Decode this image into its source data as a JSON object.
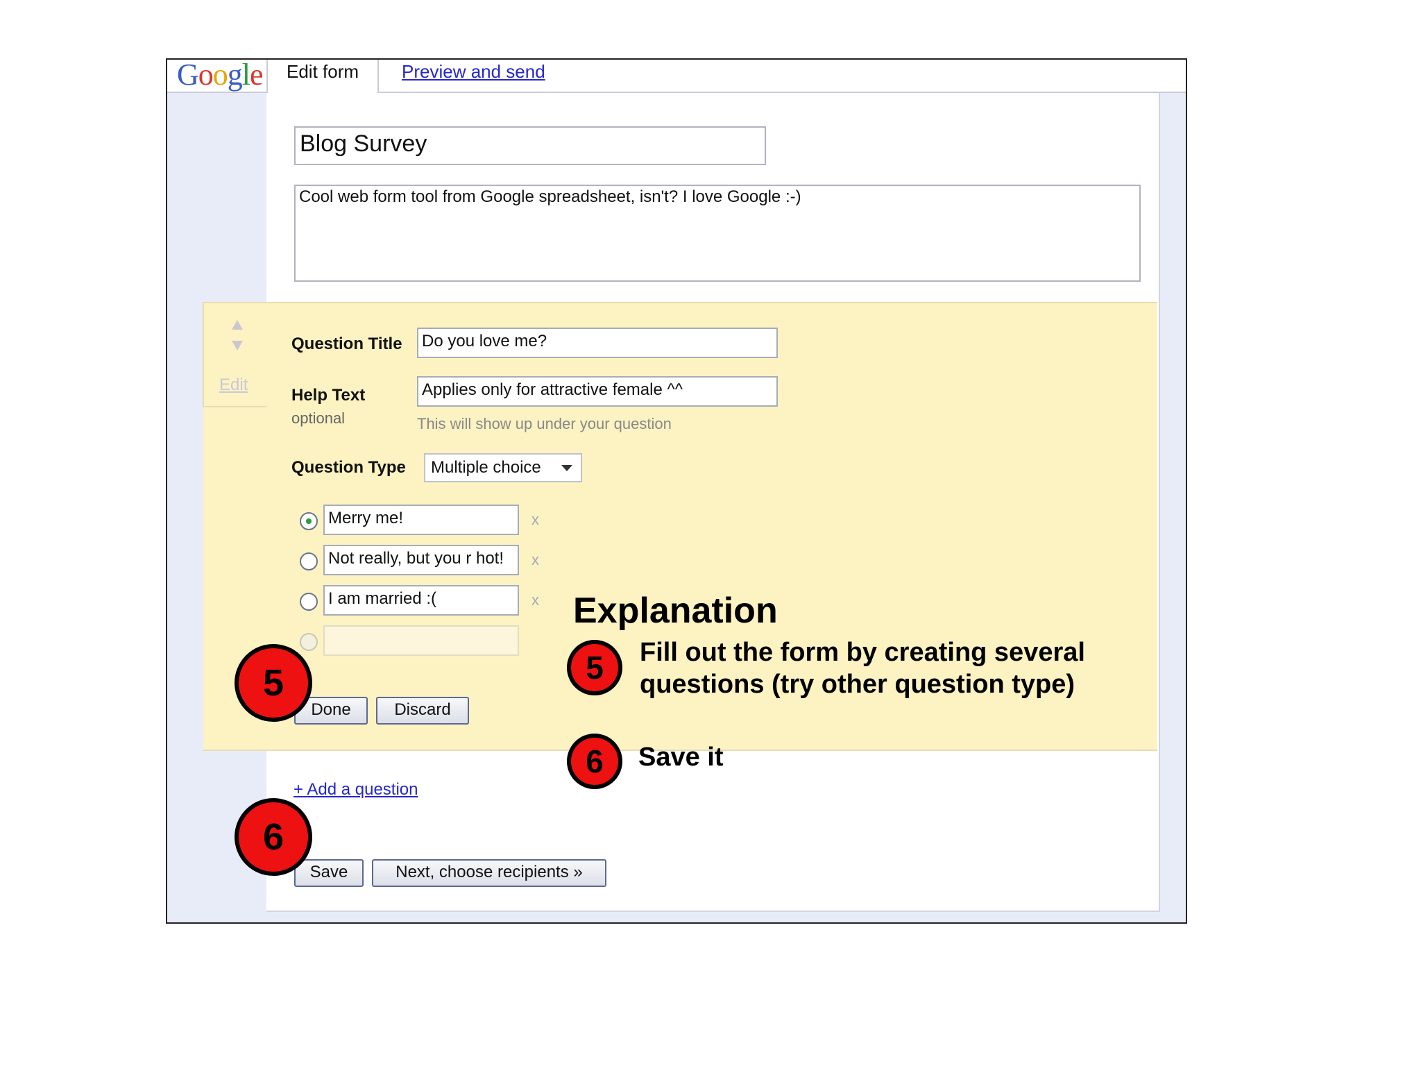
{
  "header": {
    "logo_letters": [
      {
        "ch": "G",
        "color": "#3a5cc6"
      },
      {
        "ch": "o",
        "color": "#d63a2a"
      },
      {
        "ch": "o",
        "color": "#e8a500"
      },
      {
        "ch": "g",
        "color": "#3a5cc6"
      },
      {
        "ch": "l",
        "color": "#2a9c3a"
      },
      {
        "ch": "e",
        "color": "#d63a2a"
      }
    ],
    "tab_edit": "Edit form",
    "tab_preview": "Preview and send"
  },
  "form": {
    "title": "Blog Survey",
    "description": "Cool web form tool from Google spreadsheet, isn't? I love Google :-)"
  },
  "question": {
    "edit_link": "Edit",
    "title_label": "Question Title",
    "title_value": "Do you love me?",
    "help_label": "Help Text",
    "help_optional": "optional",
    "help_value": "Applies only for attractive female ^^",
    "help_hint": "This will show up under your question",
    "type_label": "Question Type",
    "type_value": "Multiple choice",
    "options": [
      {
        "text": "Merry me!",
        "remove": "x"
      },
      {
        "text": "Not really, but you r hot!",
        "remove": "x"
      },
      {
        "text": "I am married :(",
        "remove": "x"
      }
    ],
    "done_label": "Done",
    "discard_label": "Discard"
  },
  "footer": {
    "add_question": "+ Add a question",
    "save_label": "Save",
    "next_label": "Next, choose recipients »"
  },
  "annotations": {
    "badge_5": "5",
    "badge_6": "6",
    "explanation_title": "Explanation",
    "step5_line1": "Fill out the form by creating several",
    "step5_line2": "questions (try other question type)",
    "step6_text": "Save it",
    "badge_color": "#ee1111"
  }
}
